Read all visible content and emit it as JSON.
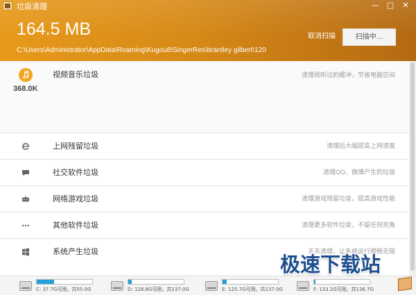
{
  "window": {
    "title": "垃圾清理",
    "min_glyph": "—",
    "max_glyph": "□",
    "close_glyph": "✕"
  },
  "header": {
    "size": "164.5 MB",
    "path": "C:\\Users\\Administrator\\AppData\\Roaming\\Kugou8\\SingerRes\\brantley gilbert\\120",
    "cancel_label": "取消扫描",
    "scanning_label": "扫描中..."
  },
  "categories": [
    {
      "title": "视频音乐垃圾",
      "desc": "清理视听过的缓冲，节省电脑空间",
      "icon": "music-note-icon",
      "count": "368.0K"
    },
    {
      "title": "上网残留垃圾",
      "desc": "清理后大幅提高上网速度",
      "icon": "browser-e-icon"
    },
    {
      "title": "社交软件垃圾",
      "desc": "清理QQ、微博产生的垃圾",
      "icon": "chat-bubble-icon"
    },
    {
      "title": "网络游戏垃圾",
      "desc": "清理游戏残留垃圾，提高游戏性能",
      "icon": "game-controller-icon"
    },
    {
      "title": "其他软件垃圾",
      "desc": "清理更多软件垃圾，不留任何死角",
      "icon": "more-dots-icon"
    },
    {
      "title": "系统产生垃圾",
      "desc": "天天清理，让系统运行顺畅无阻",
      "icon": "windows-logo-icon"
    }
  ],
  "drives": [
    {
      "label": "C: 37.7G可用，共55.0G",
      "used_fraction": 0.31
    },
    {
      "label": "D: 128.8G可用，共137.0G",
      "used_fraction": 0.06
    },
    {
      "label": "E: 125.7G可用，共137.0G",
      "used_fraction": 0.08
    },
    {
      "label": "F: 133.2G可用，共136.7G",
      "used_fraction": 0.03
    }
  ],
  "watermark": {
    "text": "极速下载站"
  },
  "colors": {
    "accent": "#e79a1b",
    "drive_fill": "#26a0da",
    "watermark": "#1e4e8e"
  }
}
